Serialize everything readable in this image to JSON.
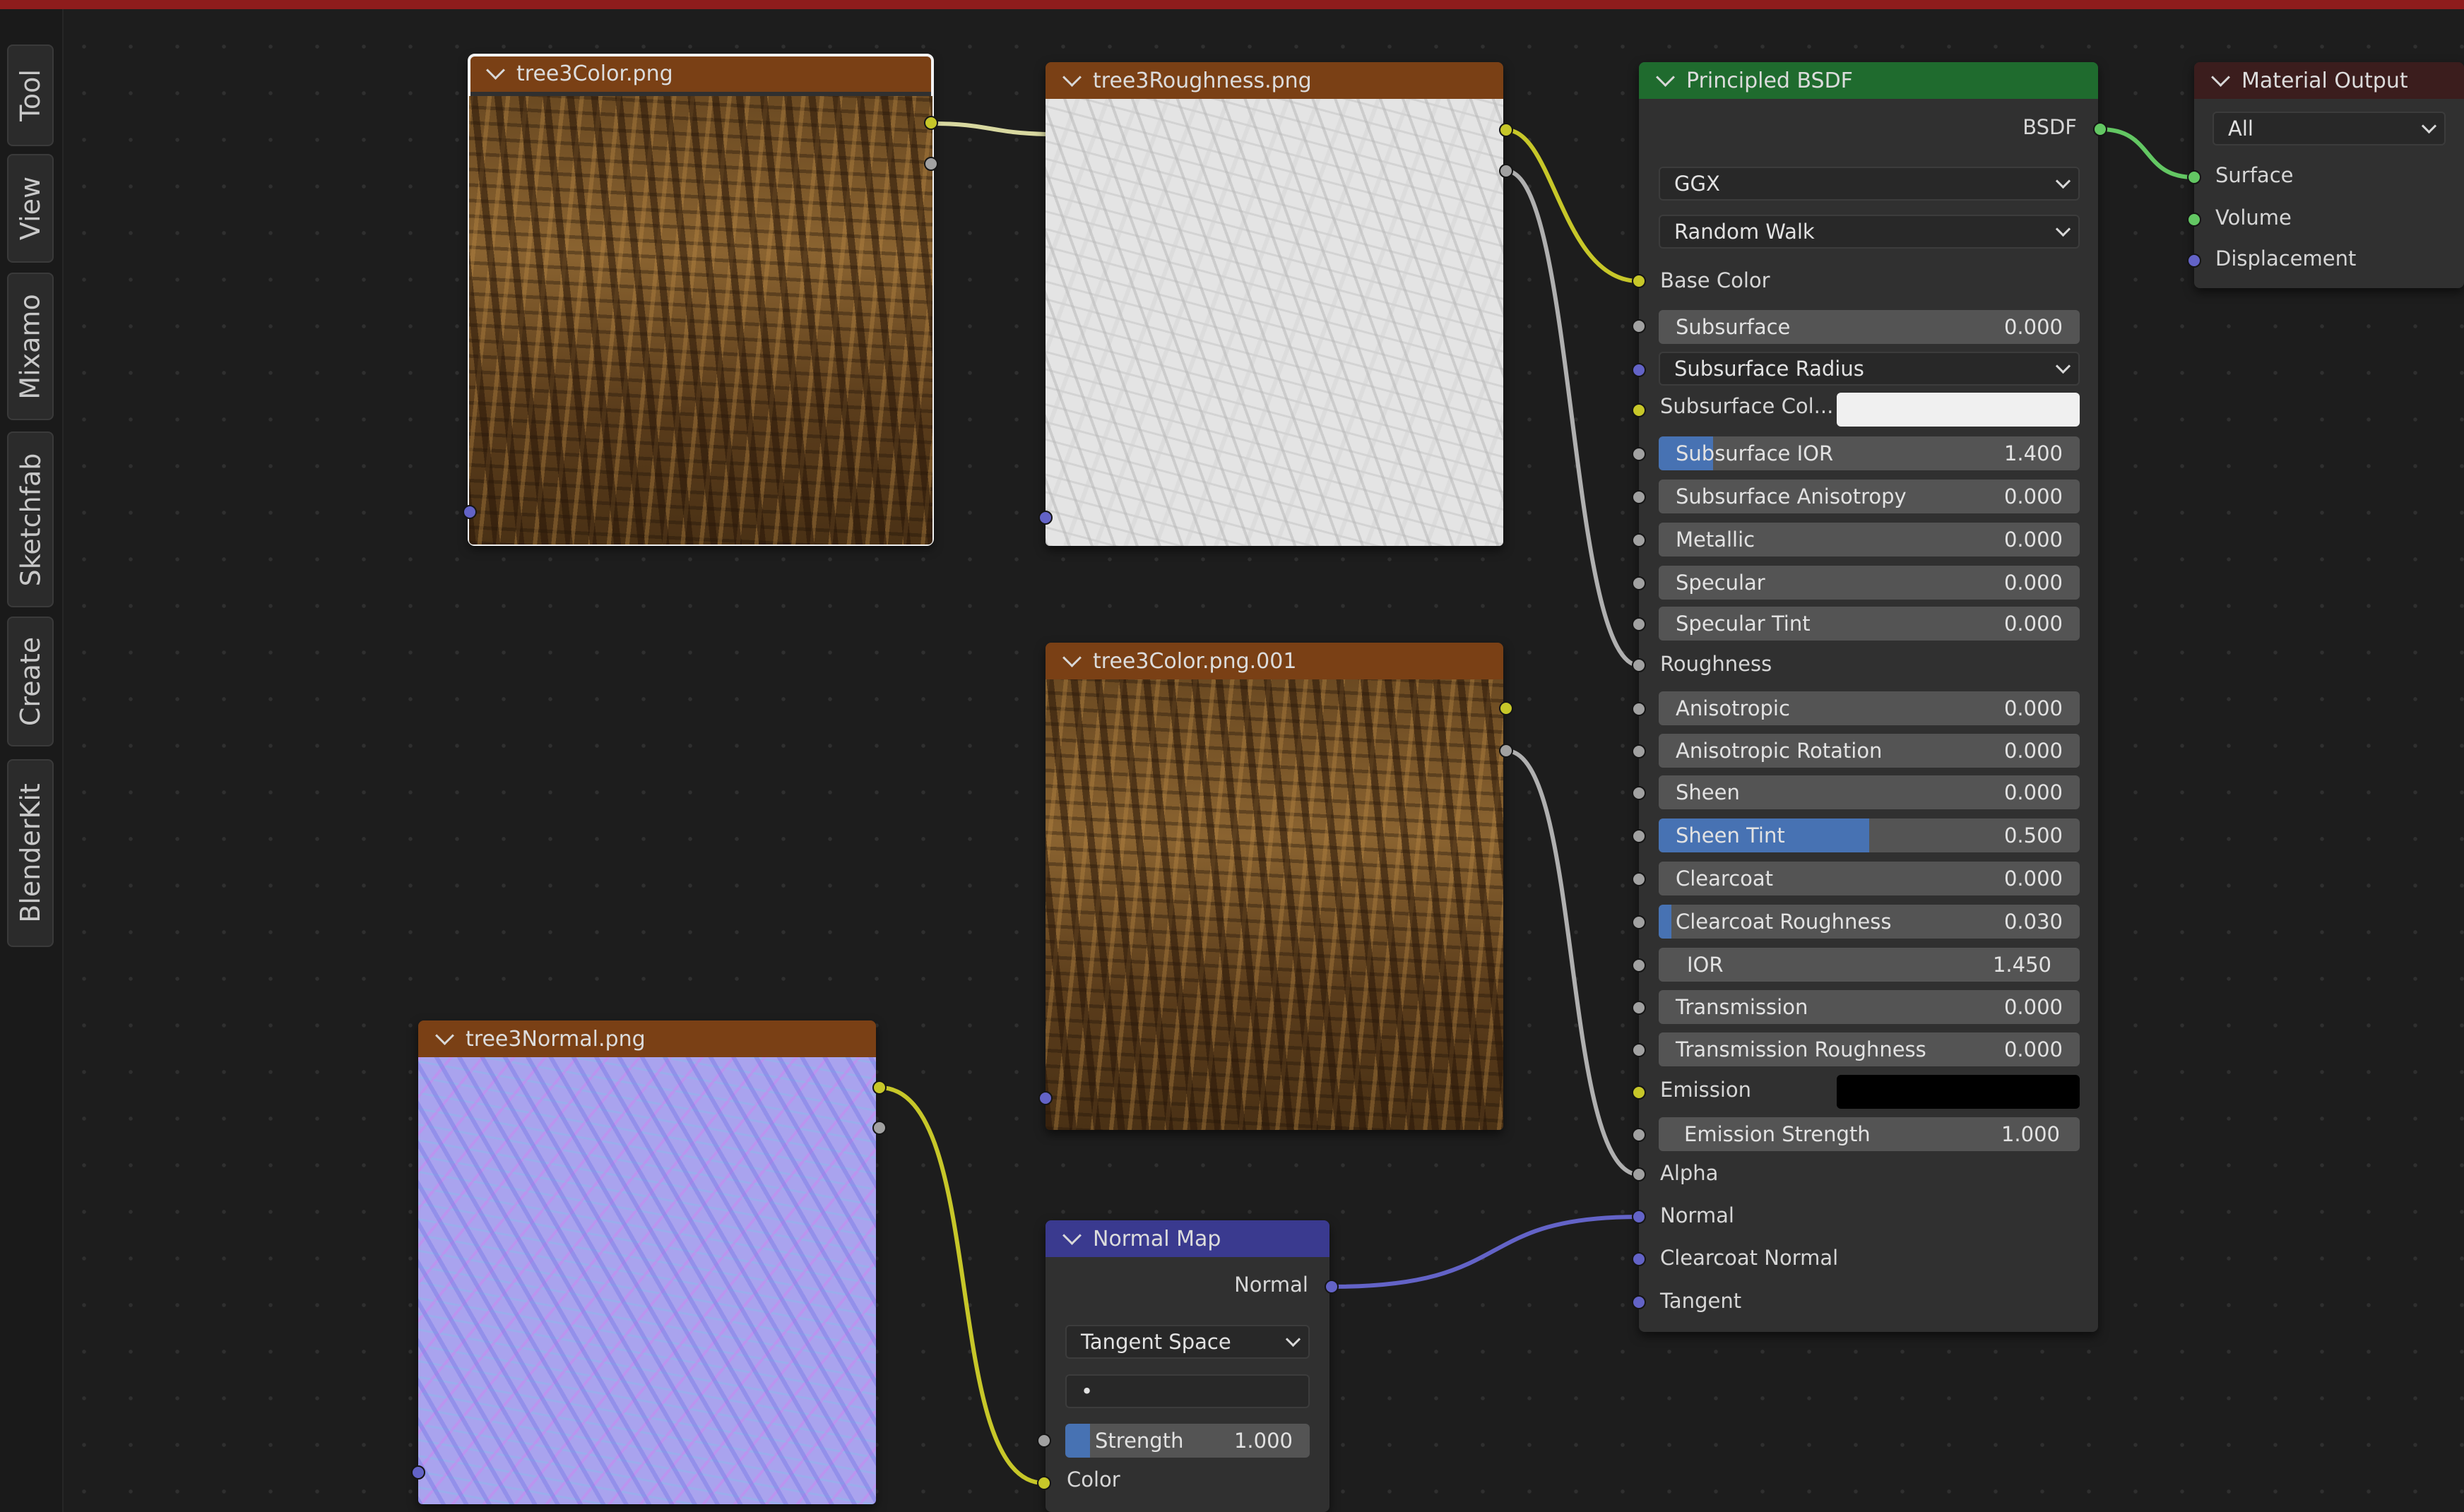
{
  "window": {
    "accent_bar_color": "#8e1c1c",
    "background": "#1d1d1d"
  },
  "sidebar_tabs": [
    "Tool",
    "View",
    "Mixamo",
    "Sketchfab",
    "Create",
    "BlenderKit"
  ],
  "nodes": {
    "tex_color": {
      "title": "tree3Color.png"
    },
    "tex_roughness": {
      "title": "tree3Roughness.png"
    },
    "tex_color_001": {
      "title": "tree3Color.png.001"
    },
    "tex_normal": {
      "title": "tree3Normal.png"
    },
    "normal_map": {
      "title": "Normal Map",
      "output_normal": "Normal",
      "space": "Tangent Space",
      "uv": "•",
      "strength_label": "Strength",
      "strength_value": "1.000",
      "strength_fraction": 0.1,
      "input_color": "Color"
    },
    "bsdf": {
      "title": "Principled BSDF",
      "output": "BSDF",
      "distribution": "GGX",
      "subsurface_method": "Random Walk",
      "base_color": "Base Color",
      "subsurface": {
        "label": "Subsurface",
        "value": "0.000",
        "fraction": 0
      },
      "subsurface_radius": "Subsurface Radius",
      "subsurface_color": {
        "label": "Subsurface Col...",
        "color": "#f0f0f0"
      },
      "subsurface_ior": {
        "label": "Subsurface IOR",
        "value": "1.400",
        "fraction": 0.13
      },
      "subsurface_anisotropy": {
        "label": "Subsurface Anisotropy",
        "value": "0.000",
        "fraction": 0
      },
      "metallic": {
        "label": "Metallic",
        "value": "0.000",
        "fraction": 0
      },
      "specular": {
        "label": "Specular",
        "value": "0.000",
        "fraction": 0
      },
      "specular_tint": {
        "label": "Specular Tint",
        "value": "0.000",
        "fraction": 0
      },
      "roughness": "Roughness",
      "anisotropic": {
        "label": "Anisotropic",
        "value": "0.000",
        "fraction": 0
      },
      "anisotropic_rotation": {
        "label": "Anisotropic Rotation",
        "value": "0.000",
        "fraction": 0
      },
      "sheen": {
        "label": "Sheen",
        "value": "0.000",
        "fraction": 0
      },
      "sheen_tint": {
        "label": "Sheen Tint",
        "value": "0.500",
        "fraction": 0.5
      },
      "clearcoat": {
        "label": "Clearcoat",
        "value": "0.000",
        "fraction": 0
      },
      "clearcoat_roughness": {
        "label": "Clearcoat Roughness",
        "value": "0.030",
        "fraction": 0.03
      },
      "ior": {
        "label": "IOR",
        "value": "1.450"
      },
      "transmission": {
        "label": "Transmission",
        "value": "0.000",
        "fraction": 0
      },
      "transmission_roughness": {
        "label": "Transmission Roughness",
        "value": "0.000",
        "fraction": 0
      },
      "emission": {
        "label": "Emission",
        "color": "#000000"
      },
      "emission_strength": {
        "label": "Emission Strength",
        "value": "1.000"
      },
      "alpha": "Alpha",
      "normal": "Normal",
      "clearcoat_normal": "Clearcoat Normal",
      "tangent": "Tangent"
    },
    "material_output": {
      "title": "Material Output",
      "target": "All",
      "inputs": [
        "Surface",
        "Volume",
        "Displacement"
      ]
    }
  },
  "socket_colors": {
    "color": "#c7c729",
    "float": "#a1a1a1",
    "vector": "#6363c7",
    "shader": "#63c763"
  }
}
